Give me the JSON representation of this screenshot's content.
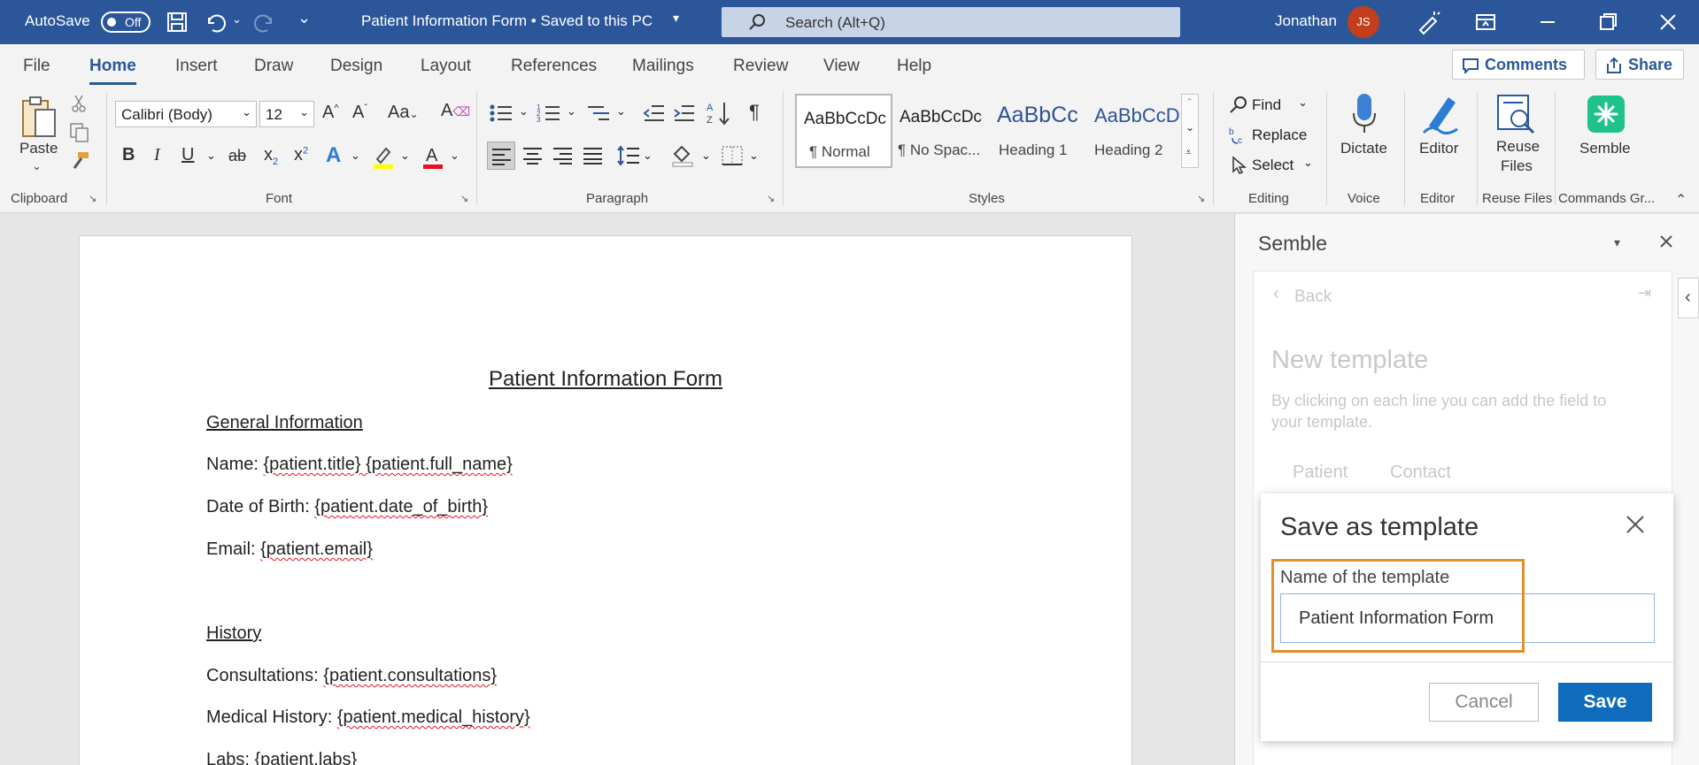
{
  "titlebar": {
    "autosave": "AutoSave",
    "toggle": "Off",
    "doc_title": "Patient Information Form • Saved to this PC",
    "search_placeholder": "Search (Alt+Q)",
    "user": "Jonathan",
    "initials": "JS"
  },
  "tabs": [
    "File",
    "Home",
    "Insert",
    "Draw",
    "Design",
    "Layout",
    "References",
    "Mailings",
    "Review",
    "View",
    "Help"
  ],
  "top_buttons": {
    "comments": "Comments",
    "share": "Share"
  },
  "ribbon": {
    "clipboard": {
      "paste": "Paste",
      "label": "Clipboard"
    },
    "font": {
      "name": "Calibri (Body)",
      "size": "12",
      "label": "Font"
    },
    "paragraph": {
      "label": "Paragraph"
    },
    "styles": {
      "items": [
        {
          "sample": "AaBbCcDc",
          "name": "¶ Normal"
        },
        {
          "sample": "AaBbCcDc",
          "name": "¶ No Spac..."
        },
        {
          "sample": "AaBbCc",
          "name": "Heading 1"
        },
        {
          "sample": "AaBbCcD",
          "name": "Heading 2"
        }
      ],
      "label": "Styles"
    },
    "editing": {
      "find": "Find",
      "replace": "Replace",
      "select": "Select",
      "label": "Editing"
    },
    "voice": {
      "dictate": "Dictate",
      "label": "Voice"
    },
    "editor": {
      "btn": "Editor",
      "label": "Editor"
    },
    "reuse": {
      "btn1": "Reuse",
      "btn2": "Files",
      "label": "Reuse Files"
    },
    "semble": {
      "btn": "Semble",
      "label": "Commands Gr..."
    }
  },
  "document": {
    "title": "Patient Information Form",
    "section1": "General Information",
    "name_label": "Name: ",
    "name_value": "{patient.title} {patient.full_name}",
    "dob_label": "Date of Birth: ",
    "dob_value": "{patient.date_of_birth}",
    "email_label": "Email: ",
    "email_value": "{patient.email}",
    "section2": "History",
    "consult_label": "Consultations: ",
    "consult_value": "{patient.consultations}",
    "medhist_label": "Medical History: ",
    "medhist_value": "{patient.medical_history}",
    "labs_label": "Labs: ",
    "labs_value": "{patient.labs}"
  },
  "pane": {
    "title": "Semble",
    "back": "Back",
    "heading": "New template",
    "desc1": "By clicking on each line you can add the field to",
    "desc2": "your template.",
    "tab1": "Patient",
    "tab2": "Contact"
  },
  "modal": {
    "title": "Save as template",
    "field_label": "Name of the template",
    "field_value": "Patient Information Form",
    "cancel": "Cancel",
    "save": "Save"
  },
  "colors": {
    "word_blue": "#2b579a",
    "save_blue": "#0f6cbd",
    "highlight": "#e0912a",
    "semble_green": "#1fc28b"
  }
}
